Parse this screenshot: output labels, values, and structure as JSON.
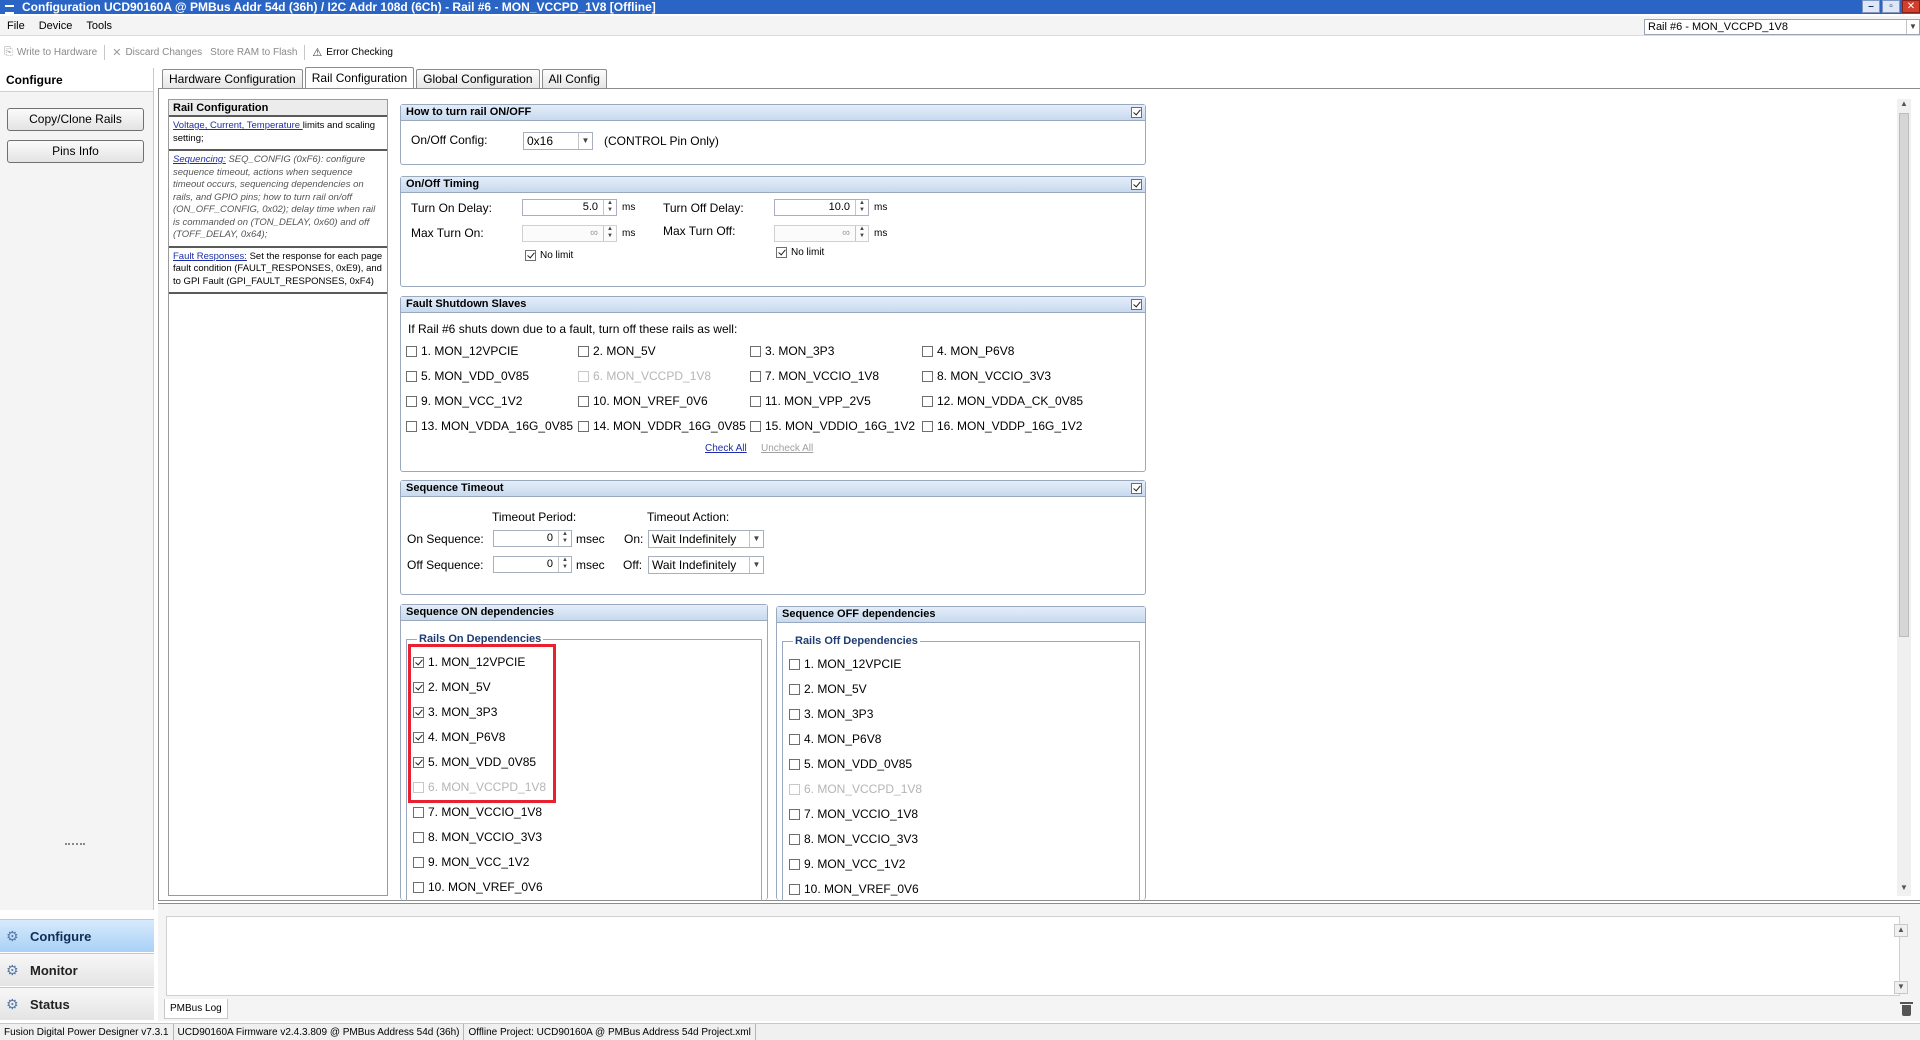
{
  "title": "Configuration UCD90160A @ PMBus Addr 54d (36h) / I2C Addr 108d (6Ch)  - Rail #6 - MON_VCCPD_1V8 [Offline]",
  "window_buttons": {
    "minimize": "–",
    "restore": "▫",
    "close": "✕"
  },
  "menu": {
    "file": "File",
    "device": "Device",
    "tools": "Tools"
  },
  "rail_selector": {
    "value": "Rail #6 - MON_VCCPD_1V8"
  },
  "toolbar": {
    "write": "Write to Hardware",
    "discard": "Discard Changes",
    "store": "Store RAM to Flash",
    "error": "Error Checking"
  },
  "leftnav": {
    "title": "Configure",
    "copy_clone": "Copy/Clone Rails",
    "pins_info": "Pins Info",
    "sections": {
      "configure": "Configure",
      "monitor": "Monitor",
      "status": "Status"
    }
  },
  "tabs": [
    "Hardware Configuration",
    "Rail Configuration",
    "Global Configuration",
    "All Config"
  ],
  "info": {
    "title": "Rail Configuration",
    "b1_link": "Voltage, Current, Temperature ",
    "b1_text": "limits and scaling setting;",
    "b2_link": "Sequencing:",
    "b2_text": " SEQ_CONFIG (0xF6): configure sequence timeout, actions when sequence timeout occurs, sequencing dependencies on rails, and GPIO pins; how to turn rail on/off (ON_OFF_CONFIG, 0x02); delay time when rail is commanded on (TON_DELAY, 0x60) and off (TOFF_DELAY, 0x64);",
    "b3_link": "Fault Responses:",
    "b3_text": " Set the response for each page fault condition (FAULT_RESPONSES, 0xE9), and to GPI Fault (GPI_FAULT_RESPONSES, 0xF4)"
  },
  "onoff": {
    "title": "How to turn rail ON/OFF",
    "label": "On/Off Config:",
    "value": "0x16",
    "note": "(CONTROL Pin Only)"
  },
  "timing": {
    "title": "On/Off Timing",
    "turn_on_label": "Turn On Delay:",
    "turn_on_value": "5.0",
    "turn_off_label": "Turn Off Delay:",
    "turn_off_value": "10.0",
    "max_on_label": "Max Turn On:",
    "max_off_label": "Max Turn Off:",
    "max_value": "∞",
    "unit": "ms",
    "nolimit": "No limit"
  },
  "fault": {
    "title": "Fault Shutdown Slaves",
    "prompt": "If Rail #6 shuts down due to a fault, turn off these rails as well:",
    "check_all": "Check All",
    "uncheck_all": "Uncheck All",
    "rails": [
      "1. MON_12VPCIE",
      "2. MON_5V",
      "3. MON_3P3",
      "4. MON_P6V8",
      "5. MON_VDD_0V85",
      "6. MON_VCCPD_1V8",
      "7. MON_VCCIO_1V8",
      "8. MON_VCCIO_3V3",
      "9. MON_VCC_1V2",
      "10. MON_VREF_0V6",
      "11. MON_VPP_2V5",
      "12. MON_VDDA_CK_0V85",
      "13. MON_VDDA_16G_0V85",
      "14. MON_VDDR_16G_0V85",
      "15. MON_VDDIO_16G_1V2",
      "16. MON_VDDP_16G_1V2"
    ]
  },
  "timeout": {
    "title": "Sequence Timeout",
    "period_label": "Timeout Period:",
    "action_label": "Timeout Action:",
    "on_seq_label": "On Sequence:",
    "off_seq_label": "Off Sequence:",
    "on_value": "0",
    "off_value": "0",
    "unit": "msec",
    "on_label": "On:",
    "off_label": "Off:",
    "on_action": "Wait Indefinitely",
    "off_action": "Wait Indefinitely"
  },
  "seq_on": {
    "title": "Sequence ON dependencies",
    "sub": "Rails On Dependencies",
    "rails": [
      "1. MON_12VPCIE",
      "2. MON_5V",
      "3. MON_3P3",
      "4. MON_P6V8",
      "5. MON_VDD_0V85",
      "6. MON_VCCPD_1V8",
      "7. MON_VCCIO_1V8",
      "8. MON_VCCIO_3V3",
      "9. MON_VCC_1V2",
      "10. MON_VREF_0V6"
    ]
  },
  "seq_off": {
    "title": "Sequence OFF dependencies",
    "sub": "Rails Off Dependencies",
    "rails": [
      "1. MON_12VPCIE",
      "2. MON_5V",
      "3. MON_3P3",
      "4. MON_P6V8",
      "5. MON_VDD_0V85",
      "6. MON_VCCPD_1V8",
      "7. MON_VCCIO_1V8",
      "8. MON_VCCIO_3V3",
      "9. MON_VCC_1V2",
      "10. MON_VREF_0V6"
    ]
  },
  "log": {
    "tab": "PMBus Log"
  },
  "status": {
    "app": "Fusion Digital Power Designer v7.3.1",
    "fw": "UCD90160A Firmware v2.4.3.809 @ PMBus Address 54d (36h)",
    "project": "Offline Project: UCD90160A @ PMBus Address 54d Project.xml"
  },
  "colors": {
    "title_bar": "#2a64c5",
    "highlight": "#e8202f",
    "link": "#1d2ea8"
  }
}
